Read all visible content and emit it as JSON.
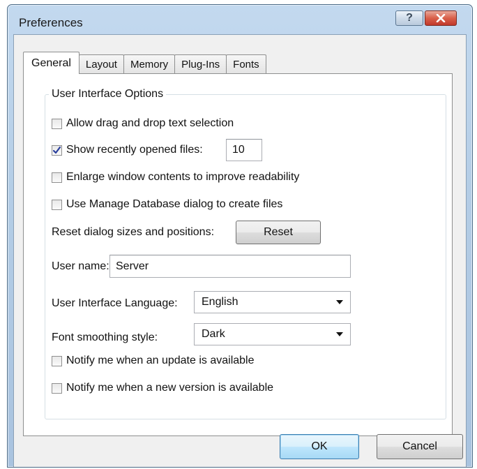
{
  "window": {
    "title": "Preferences",
    "help_glyph": "?",
    "close_icon": "close-icon"
  },
  "tabs": [
    {
      "label": "General",
      "active": true
    },
    {
      "label": "Layout",
      "active": false
    },
    {
      "label": "Memory",
      "active": false
    },
    {
      "label": "Plug-Ins",
      "active": false
    },
    {
      "label": "Fonts",
      "active": false
    }
  ],
  "general": {
    "group_label": "User Interface Options",
    "allow_drag_drop": {
      "label": "Allow drag and drop text selection",
      "checked": false
    },
    "show_recent": {
      "label": "Show recently opened files:",
      "checked": true,
      "count": "10"
    },
    "enlarge_window": {
      "label": "Enlarge window contents to improve readability",
      "checked": false
    },
    "manage_database": {
      "label": "Use Manage Database dialog to create files",
      "checked": false
    },
    "reset_sizes": {
      "label": "Reset dialog sizes and positions:",
      "button": "Reset"
    },
    "user_name": {
      "label": "User name:",
      "value": "Server"
    },
    "ui_language": {
      "label": "User Interface Language:",
      "value": "English"
    },
    "font_smoothing": {
      "label": "Font smoothing style:",
      "value": "Dark"
    },
    "notify_update": {
      "label": "Notify me when an update is available",
      "checked": false
    },
    "notify_version": {
      "label": "Notify me when a new version is available",
      "checked": false
    }
  },
  "footer": {
    "ok": "OK",
    "cancel": "Cancel"
  },
  "colors": {
    "titlebar": "#b4cde6",
    "close_button": "#c0392b",
    "default_button": "#bee6fd"
  }
}
